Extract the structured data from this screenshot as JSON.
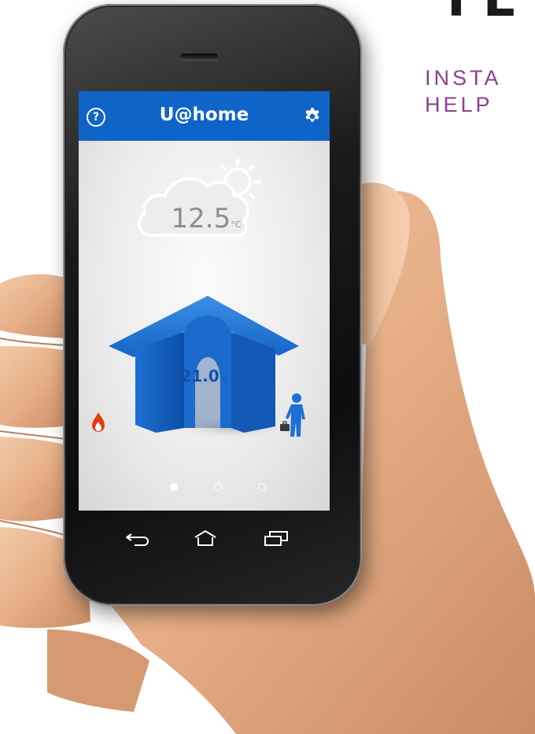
{
  "background": {
    "heading_fragment": "FL",
    "subtitle_lines": [
      "INSTA",
      "HELP"
    ]
  },
  "app": {
    "title": "U@home",
    "help_icon": "help-circle-icon",
    "settings_icon": "gear-icon"
  },
  "weather": {
    "icon": "cloud-sun-icon",
    "temperature": "12.5",
    "unit": "°C"
  },
  "house": {
    "icon": "house-icon",
    "temperature": "21.0",
    "unit": "°C"
  },
  "status": {
    "heating_icon": "flame-icon",
    "heating_color": "#e43a12",
    "presence_icon": "person-with-briefcase-icon",
    "presence_color": "#1f6fd6"
  },
  "pager": {
    "count": 3,
    "active_index": 0
  },
  "system_nav": {
    "back_icon": "back-arrow-icon",
    "home_icon": "home-outline-icon",
    "recents_icon": "recent-apps-icon"
  },
  "colors": {
    "accent": "#0f65c7",
    "headline_purple": "#8a3f8f"
  }
}
